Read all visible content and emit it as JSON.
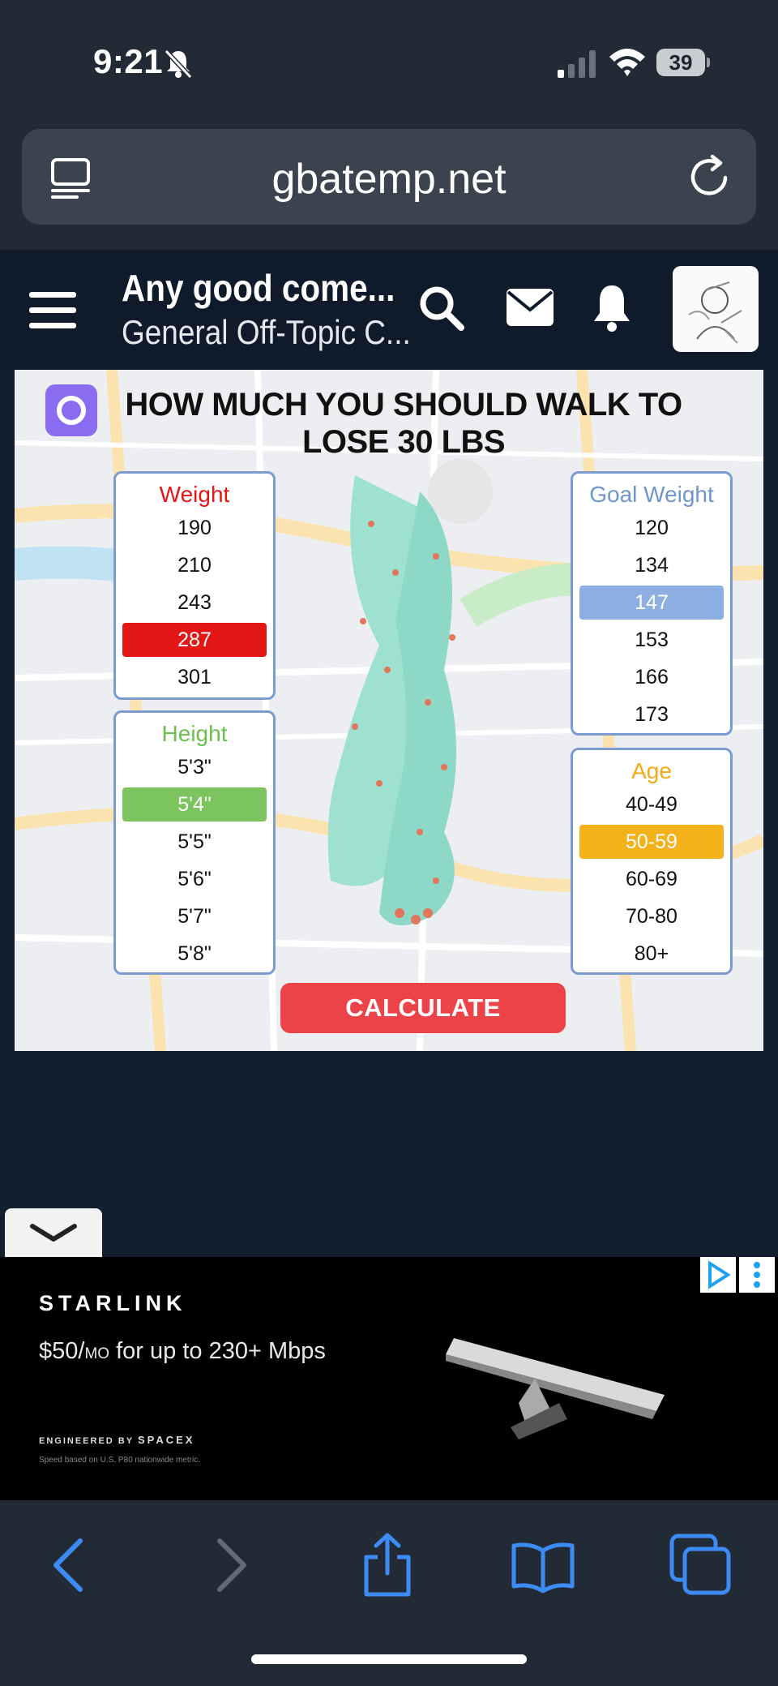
{
  "status_bar": {
    "time": "9:21",
    "battery": "39"
  },
  "browser": {
    "url": "gbatemp.net"
  },
  "site_header": {
    "thread_title": "Any good come...",
    "thread_subtitle": "General Off-Topic C..."
  },
  "ad_image": {
    "title": "HOW MUCH YOU SHOULD WALK TO LOSE 30 LBS",
    "weight": {
      "title": "Weight",
      "options": [
        "190",
        "210",
        "243",
        "287",
        "301"
      ],
      "selected": "287"
    },
    "height": {
      "title": "Height",
      "options": [
        "5'3\"",
        "5'4\"",
        "5'5\"",
        "5'6\"",
        "5'7\"",
        "5'8\""
      ],
      "selected": "5'4\""
    },
    "goal_weight": {
      "title": "Goal Weight",
      "options": [
        "120",
        "134",
        "147",
        "153",
        "166",
        "173"
      ],
      "selected": "147"
    },
    "age": {
      "title": "Age",
      "options": [
        "40-49",
        "50-59",
        "60-69",
        "70-80",
        "80+"
      ],
      "selected": "50-59"
    },
    "button_label": "CALCULATE",
    "colors": {
      "weight_title": "#e41616",
      "height_title": "#6bbf4e",
      "goal_title": "#6f95cf",
      "age_title": "#f4a916",
      "calculate": "#ec4348"
    }
  },
  "banner": {
    "brand": "STARLINK",
    "price": "$50/",
    "price_unit": "MO",
    "price_desc": " for up to 230+ Mbps",
    "engineered_by": "ENGINEERED BY",
    "engineered_brand": "SPACEX",
    "disclaimer": "Speed based on U.S. P80 nationwide metric."
  }
}
